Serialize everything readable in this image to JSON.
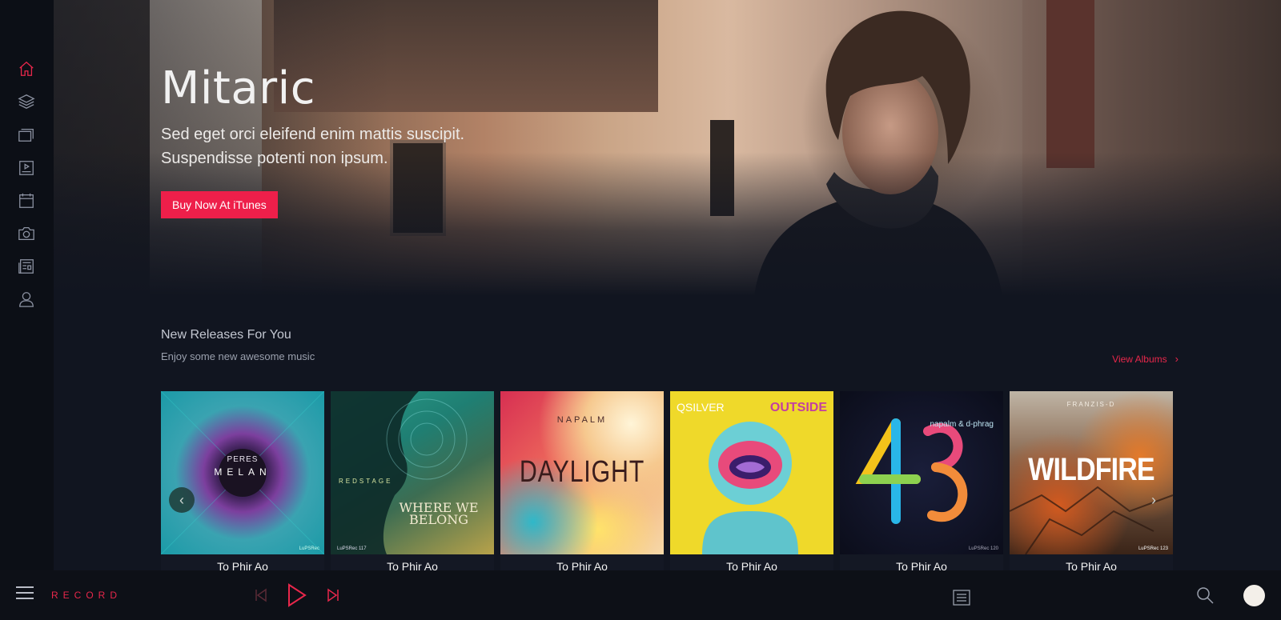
{
  "brand": "RECORD",
  "hero": {
    "title": "Mitaric",
    "subtitle_line1": "Sed eget orci eleifend enim mattis suscipit.",
    "subtitle_line2": "Suspendisse potenti non ipsum.",
    "cta_label": "Buy Now At iTunes"
  },
  "sidebar": {
    "items": [
      {
        "name": "home",
        "icon": "home-icon",
        "active": true
      },
      {
        "name": "layers",
        "icon": "layers-icon",
        "active": false
      },
      {
        "name": "albums",
        "icon": "album-stack-icon",
        "active": false
      },
      {
        "name": "videos",
        "icon": "video-icon",
        "active": false
      },
      {
        "name": "events",
        "icon": "calendar-icon",
        "active": false
      },
      {
        "name": "photos",
        "icon": "camera-icon",
        "active": false
      },
      {
        "name": "news",
        "icon": "newspaper-icon",
        "active": false
      },
      {
        "name": "artists",
        "icon": "user-icon",
        "active": false
      }
    ]
  },
  "section": {
    "title": "New Releases For You",
    "subtitle": "Enjoy some new awesome music",
    "view_all": "View Albums",
    "view_all_icon": "chevron-right-icon"
  },
  "albums": [
    {
      "title": "To Phir Ao",
      "cover_text_top": "PERES",
      "cover_text_main": "MELAN",
      "cover_footer": "LuPSRec"
    },
    {
      "title": "To Phir Ao",
      "cover_text_top": "REDSTAGE",
      "cover_text_main": "WHERE WE BELONG",
      "cover_footer": "LuPSRec 117"
    },
    {
      "title": "To Phir Ao",
      "cover_text_top": "NAPALM",
      "cover_text_main": "DAYLIGHT",
      "cover_footer": ""
    },
    {
      "title": "To Phir Ao",
      "cover_text_top": "QSILVER",
      "cover_text_main": "OUTSIDE",
      "cover_footer": ""
    },
    {
      "title": "To Phir Ao",
      "cover_text_top": "napalm & d-phrag",
      "cover_text_main": "43",
      "cover_footer": "LuPSRec 120"
    },
    {
      "title": "To Phir Ao",
      "cover_text_top": "FRANZIS-D",
      "cover_text_main": "WILDFIRE",
      "cover_footer": "LuPSRec 123"
    }
  ],
  "colors": {
    "accent": "#e8274b",
    "background": "#111520",
    "sidebar": "#0c0f16"
  }
}
